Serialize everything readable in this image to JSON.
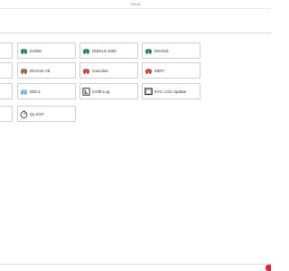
{
  "window": {
    "title": "VIDIA"
  },
  "tiles": [
    {
      "label": "",
      "icon": "blank-icon"
    },
    {
      "label": "D4/D6",
      "icon": "green-truck-icon",
      "color": "#2e8b6e"
    },
    {
      "label": "D8/D13-1000",
      "icon": "green-truck-icon",
      "color": "#2e8b6e"
    },
    {
      "label": "D9-D16",
      "icon": "green-truck-icon",
      "color": "#2e8b6e"
    },
    {
      "label": "",
      "icon": "blank-icon"
    },
    {
      "label": "D5-D16 VE",
      "icon": "brown-truck-icon",
      "color": "#9a6b4f"
    },
    {
      "label": "Gasoline",
      "icon": "red-truck-icon",
      "color": "#d24a4a"
    },
    {
      "label": "MEFI",
      "icon": "red-truck-icon",
      "color": "#d24a4a"
    },
    {
      "label": "",
      "icon": "blank-icon"
    },
    {
      "label": "EDC1",
      "icon": "blue-truck-icon",
      "color": "#7ec3d8"
    },
    {
      "label": "COM Log",
      "icon": "document-l-icon",
      "color": "#222222"
    },
    {
      "label": "EVC LCD Update",
      "icon": "monitor-icon",
      "color": "#222222"
    },
    {
      "label": "",
      "icon": "blank-icon"
    },
    {
      "label": "QL EST",
      "icon": "gauge-icon",
      "color": "#444444"
    }
  ],
  "colors": {
    "accent": "#d9262c",
    "border": "#cfcfcf"
  }
}
